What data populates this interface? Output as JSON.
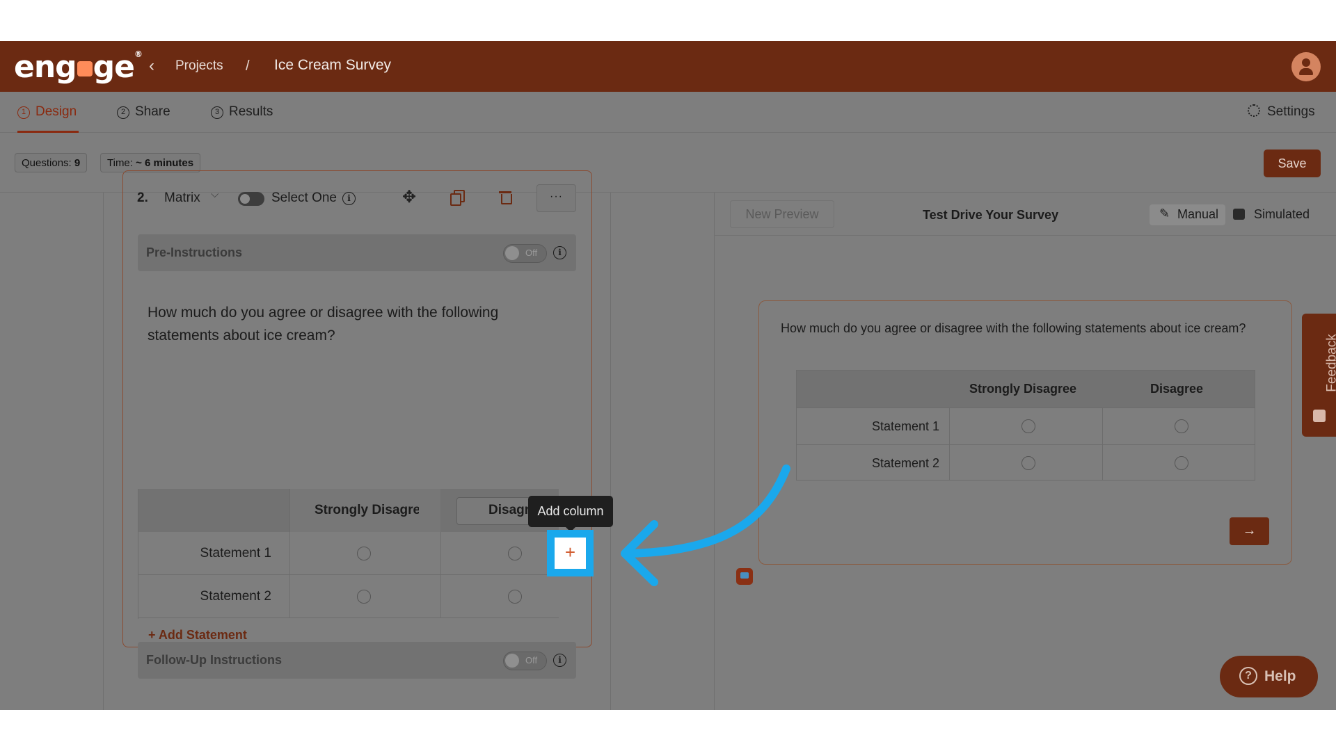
{
  "header": {
    "logo_text": "engage",
    "back_icon": "chevron-left-icon",
    "breadcrumb_projects": "Projects",
    "breadcrumb_sep": "/",
    "survey_title": "Ice Cream Survey"
  },
  "tabs": [
    {
      "num": "1",
      "label": "Design",
      "active": true
    },
    {
      "num": "2",
      "label": "Share"
    },
    {
      "num": "3",
      "label": "Results"
    }
  ],
  "settings_label": "Settings",
  "stats": {
    "questions_label": "Questions:",
    "questions_value": "9",
    "time_label": "Time:",
    "time_value": "~ 6 minutes"
  },
  "save_label": "Save",
  "question": {
    "number": "2.",
    "type": "Matrix",
    "select_one_label": "Select One",
    "more_label": "···",
    "pre_instructions_label": "Pre-Instructions",
    "pre_instructions_toggle": "Off",
    "text": "How much do you agree or disagree with the following statements about ice cream?",
    "columns": [
      "Strongly Disagree",
      "Disagree"
    ],
    "statements": [
      "Statement 1",
      "Statement 2"
    ],
    "add_statement_label": "+ Add Statement",
    "follow_up_label": "Follow-Up Instructions",
    "follow_up_toggle": "Off",
    "add_column_tooltip": "Add column",
    "add_column_button": "+"
  },
  "preview": {
    "new_preview_label": "New Preview",
    "title": "Test Drive Your Survey",
    "manual_label": "Manual",
    "simulated_label": "Simulated",
    "question_text": "How much do you agree or disagree with the following statements about ice cream?",
    "columns": [
      "Strongly Disagree",
      "Disagree"
    ],
    "statements": [
      "Statement 1",
      "Statement 2"
    ],
    "next_label": "→"
  },
  "feedback_label": "Feedback",
  "help_label": "Help",
  "colors": {
    "brand": "#6b2a12",
    "accent_orange": "#d15a2d",
    "highlight_blue": "#1aa8ec",
    "overlay_gray": "#7e7e7e"
  }
}
